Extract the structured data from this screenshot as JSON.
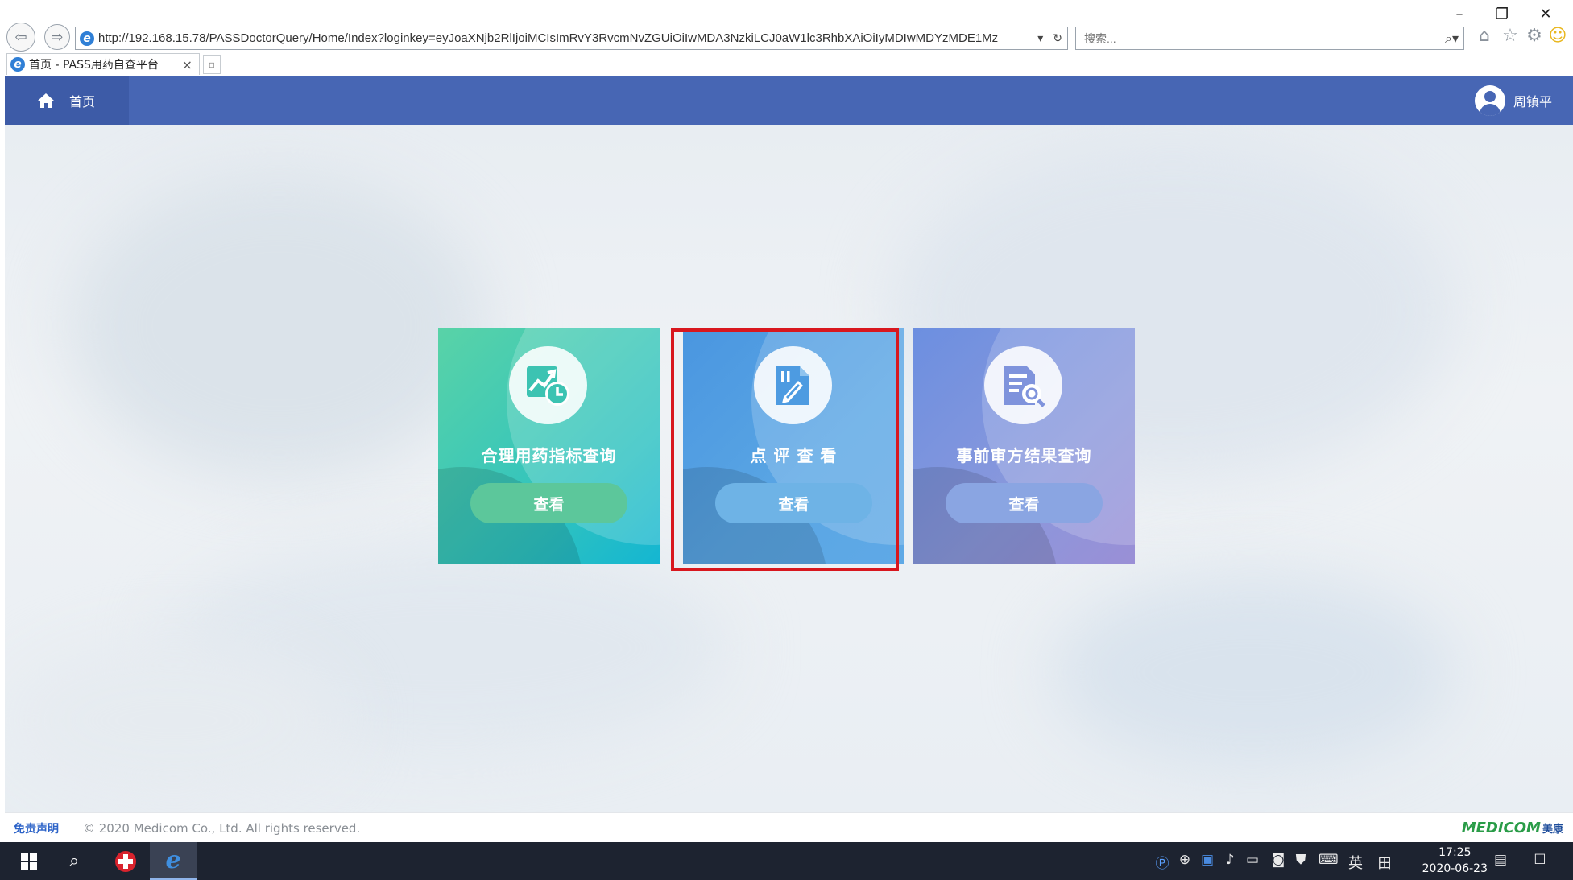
{
  "browser": {
    "url": "http://192.168.15.78/PASSDoctorQuery/Home/Index?loginkey=eyJoaXNjb2RlIjoiMCIsImRvY3RvcmNvZGUiOiIwMDA3NzkiLCJ0aW1lc3RhbXAiOiIyMDIwMDYzMDE1Mz",
    "search_placeholder": "搜索...",
    "tab_title": "首页 - PASS用药自查平台",
    "tab_close": "×"
  },
  "app": {
    "home_label": "首页",
    "user_name": "周镇平"
  },
  "cards": [
    {
      "title": "合理用药指标查询",
      "button": "查看"
    },
    {
      "title": "点 评 查 看",
      "button": "查看"
    },
    {
      "title": "事前审方结果查询",
      "button": "查看"
    }
  ],
  "footer": {
    "disclaimer": "免责声明",
    "copyright": "© 2020 Medicom Co., Ltd. All rights reserved.",
    "brand": "MEDICOM",
    "brand_cn": "美康"
  },
  "taskbar": {
    "ime_label": "英",
    "time": "17:25",
    "date": "2020-06-23"
  },
  "colors": {
    "header": "#4766b4",
    "card_indicator": "#59d3a7",
    "card_review": "#4a96e0",
    "card_prescription": "#8a98dc",
    "highlight": "#d8171e"
  },
  "icons": {
    "back": "back-arrow-icon",
    "forward": "forward-arrow-icon",
    "home": "home-icon",
    "favorites": "star-icon",
    "tools": "gear-icon",
    "feedback": "smiley-icon"
  }
}
